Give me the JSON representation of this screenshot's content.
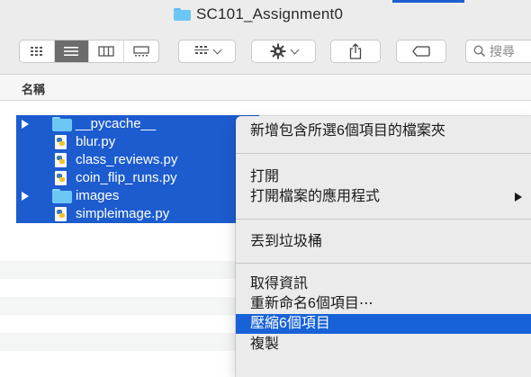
{
  "window": {
    "title": "SC101_Assignment0"
  },
  "toolbar": {
    "view_buttons": [
      "icon-view",
      "list-view",
      "column-view",
      "gallery-view"
    ],
    "active_view": "list-view",
    "group_button": "group-icon",
    "action_button": "gear-icon",
    "share_button": "share-icon",
    "tag_button": "tag-icon",
    "search_placeholder": "搜尋"
  },
  "column_header": {
    "name": "名稱"
  },
  "files": [
    {
      "name": "__pycache__",
      "type": "folder",
      "expandable": true
    },
    {
      "name": "blur.py",
      "type": "python",
      "expandable": false
    },
    {
      "name": "class_reviews.py",
      "type": "python",
      "expandable": false
    },
    {
      "name": "coin_flip_runs.py",
      "type": "python",
      "expandable": false
    },
    {
      "name": "images",
      "type": "folder",
      "expandable": true
    },
    {
      "name": "simpleimage.py",
      "type": "python",
      "expandable": false
    }
  ],
  "context_menu": {
    "items": [
      {
        "label": "新增包含所選6個項目的檔案夾"
      },
      {
        "label": "打開"
      },
      {
        "label": "打開檔案的應用程式",
        "submenu": true
      },
      {
        "label": "丟到垃圾桶"
      },
      {
        "label": "取得資訊"
      },
      {
        "label": "重新命名6個項目⋯"
      },
      {
        "label": "壓縮6個項目",
        "highlighted": true
      },
      {
        "label": "複製"
      }
    ]
  },
  "colors": {
    "selection": "#1d5ccf",
    "menu_highlight": "#1862d8",
    "folder": "#6cc7f5"
  }
}
